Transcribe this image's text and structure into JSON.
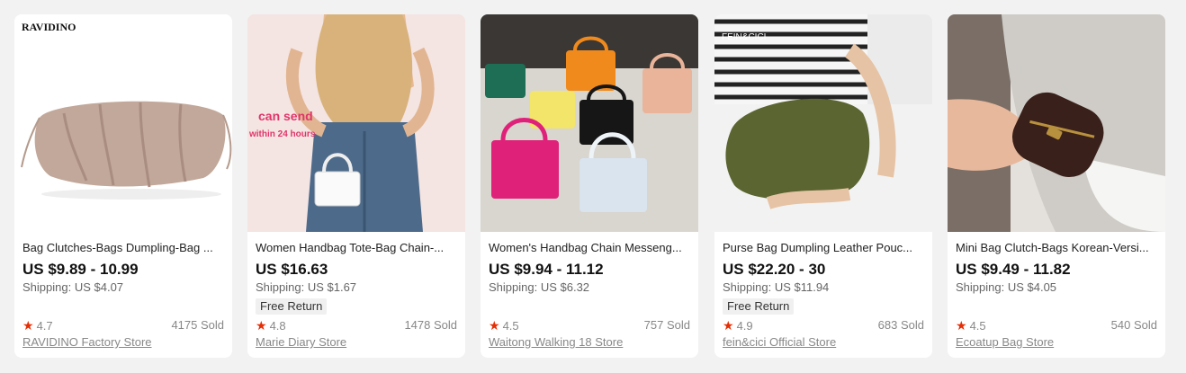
{
  "products": [
    {
      "brand_text": "RAVIDINO",
      "title": "Bag Clutches-Bags Dumpling-Bag ...",
      "price": "US $9.89 - 10.99",
      "shipping": "Shipping: US $4.07",
      "free_return": "",
      "rating": "4.7",
      "sold": "4175 Sold",
      "store": "RAVIDINO Factory Store"
    },
    {
      "overlay_text_1": "can send",
      "overlay_text_2": "within 24 hours",
      "title": "Women Handbag Tote-Bag Chain-...",
      "price": "US $16.63",
      "shipping": "Shipping: US $1.67",
      "free_return": "Free Return",
      "rating": "4.8",
      "sold": "1478 Sold",
      "store": "Marie Diary Store"
    },
    {
      "title": "Women's Handbag Chain Messeng...",
      "price": "US $9.94 - 11.12",
      "shipping": "Shipping: US $6.32",
      "free_return": "",
      "rating": "4.5",
      "sold": "757 Sold",
      "store": "Waitong Walking 18 Store"
    },
    {
      "watermark": "FEIN&CICI",
      "title": "Purse Bag Dumpling Leather Pouc...",
      "price": "US $22.20 - 30",
      "shipping": "Shipping: US $11.94",
      "free_return": "Free Return",
      "rating": "4.9",
      "sold": "683 Sold",
      "store": "fein&cici Official Store"
    },
    {
      "title": "Mini Bag Clutch-Bags Korean-Versi...",
      "price": "US $9.49 - 11.82",
      "shipping": "Shipping: US $4.05",
      "free_return": "",
      "rating": "4.5",
      "sold": "540 Sold",
      "store": "Ecoatup Bag Store"
    }
  ],
  "icons": {
    "rating": "star-icon"
  },
  "colors": {
    "star": "#e62e04",
    "background": "#f2f2f2",
    "card": "#ffffff"
  }
}
